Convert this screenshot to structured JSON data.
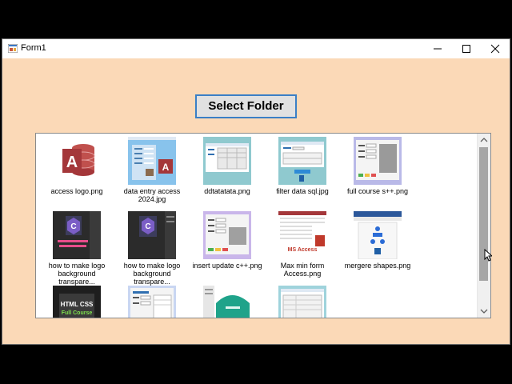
{
  "window": {
    "title": "Form1"
  },
  "controls": {
    "minimize": "minimize",
    "maximize": "maximize",
    "close": "close"
  },
  "main": {
    "select_button_label": "Select Folder"
  },
  "files": [
    {
      "name": "access logo.png",
      "icon": "ms-access-icon"
    },
    {
      "name": "data entry access\n2024.jpg",
      "icon": "image-thumbnail-icon"
    },
    {
      "name": "ddtatatata.png",
      "icon": "image-thumbnail-icon"
    },
    {
      "name": "filter data sql.jpg",
      "icon": "image-thumbnail-icon"
    },
    {
      "name": "full course s++.png",
      "icon": "image-thumbnail-icon"
    },
    {
      "name": "how to make logo\nbackground transpare...",
      "icon": "image-thumbnail-icon"
    },
    {
      "name": "how to make logo\nbackground transpare...",
      "icon": "image-thumbnail-icon"
    },
    {
      "name": "insert update c++.png",
      "icon": "image-thumbnail-icon"
    },
    {
      "name": "Max min form\nAccess.png",
      "icon": "image-thumbnail-icon"
    },
    {
      "name": "mergere shapes.png",
      "icon": "image-thumbnail-icon"
    },
    {
      "name": "",
      "icon": "image-thumbnail-icon"
    },
    {
      "name": "",
      "icon": "image-thumbnail-icon"
    },
    {
      "name": "",
      "icon": "image-thumbnail-icon"
    },
    {
      "name": "",
      "icon": "image-thumbnail-icon"
    }
  ],
  "thumb_texts": {
    "ms_access": "MS Access",
    "html_css": "HTML CSS",
    "full_course": "Full Course"
  },
  "colors": {
    "form_bg": "#fbd9b7",
    "button_border": "#3a7fc6",
    "access_red": "#a4373a"
  }
}
